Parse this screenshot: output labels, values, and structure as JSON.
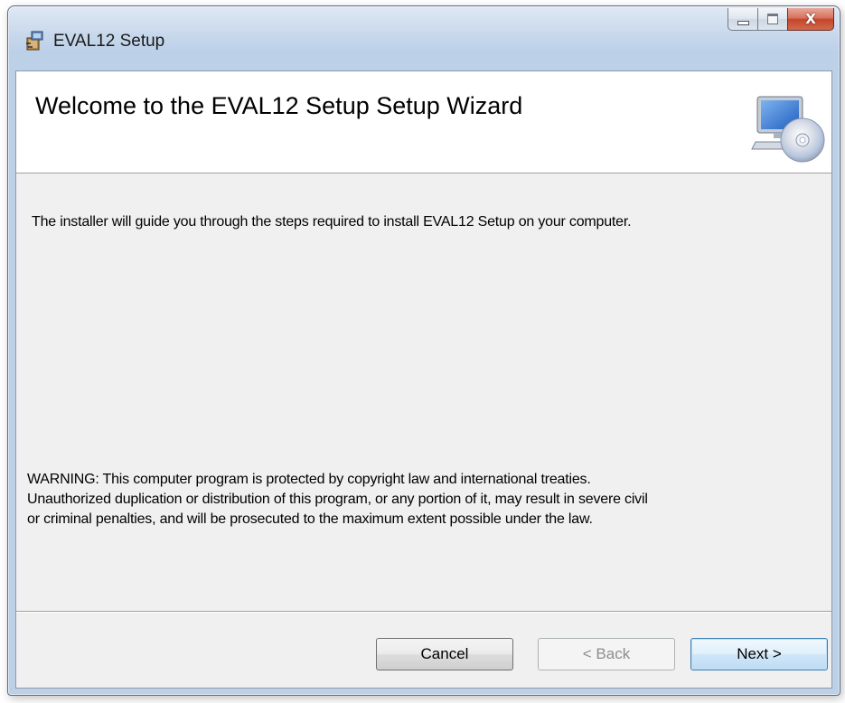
{
  "window": {
    "title": "EVAL12 Setup",
    "caption_buttons": {
      "minimize_icon": "minimize-icon",
      "maximize_icon": "maximize-icon",
      "close_label": "X"
    }
  },
  "banner": {
    "title": "Welcome to the EVAL12 Setup Setup Wizard",
    "icon": "computer-cd-icon"
  },
  "body": {
    "intro": "The installer will guide you through the steps required to install EVAL12 Setup on your computer.",
    "warning_lines": [
      "WARNING: This computer program is protected by copyright law and international treaties.",
      "Unauthorized duplication or distribution of this program, or any portion of it, may result in severe civil",
      "or criminal penalties, and will be prosecuted to the maximum extent possible under the law."
    ]
  },
  "buttons": {
    "cancel": "Cancel",
    "back": "< Back",
    "next": "Next >"
  },
  "colors": {
    "close_button": "#c5452c",
    "next_button_border": "#3c7fb1",
    "dialog_background": "#f0f0f0"
  }
}
